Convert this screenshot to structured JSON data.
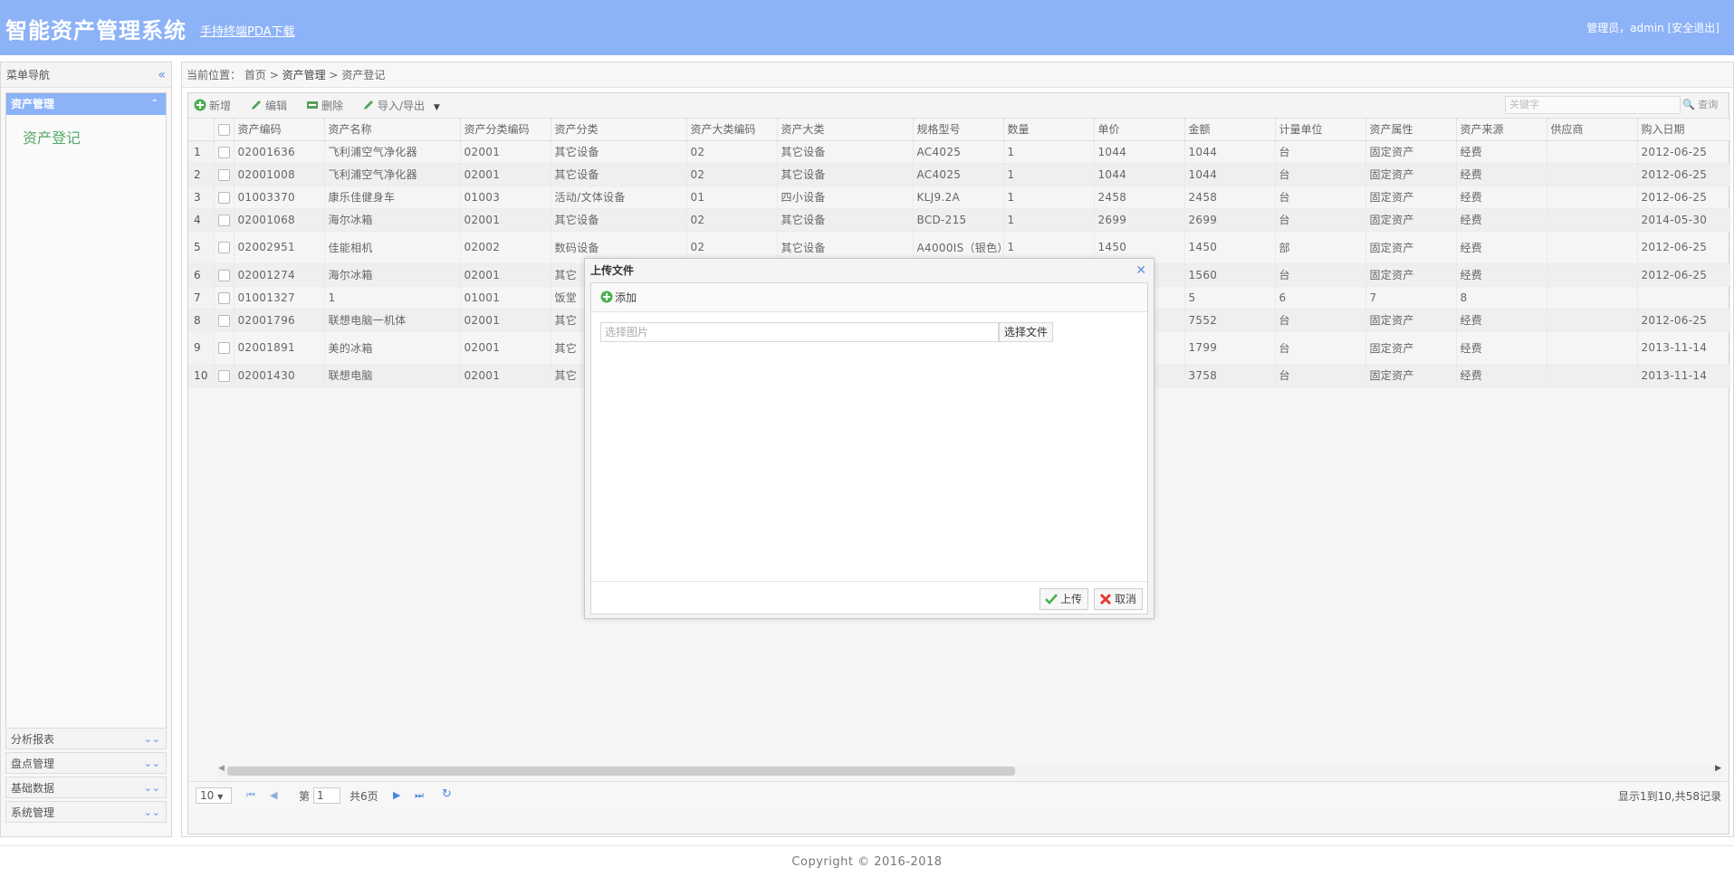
{
  "header": {
    "title": "智能资产管理系统",
    "pda_link": "手持终端PDA下载",
    "user_prefix": "管理员，admin",
    "logout": "[安全退出]"
  },
  "sidebar": {
    "title": "菜单导航",
    "active_panel": "资产管理",
    "active_item": "资产登记",
    "sections": [
      "分析报表",
      "盘点管理",
      "基础数据",
      "系统管理"
    ]
  },
  "breadcrumb": {
    "prefix": "当前位置：",
    "home": "首页",
    "sep1": ">",
    "level1": "资产管理",
    "sep2": ">",
    "level2": "资产登记"
  },
  "toolbar": {
    "add": "新增",
    "edit": "编辑",
    "delete": "删除",
    "import_export": "导入/导出",
    "search_placeholder": "关键字",
    "search": "查询"
  },
  "table": {
    "columns": [
      "资产编码",
      "资产名称",
      "资产分类编码",
      "资产分类",
      "资产大类编码",
      "资产大类",
      "规格型号",
      "数量",
      "单价",
      "金额",
      "计量单位",
      "资产属性",
      "资产来源",
      "供应商",
      "购入日期"
    ],
    "rows": [
      [
        "1",
        "02001636",
        "飞利浦空气净化器",
        "02001",
        "其它设备",
        "02",
        "其它设备",
        "AC4025",
        "1",
        "1044",
        "1044",
        "台",
        "固定资产",
        "经费",
        "",
        "2012-06-25"
      ],
      [
        "2",
        "02001008",
        "飞利浦空气净化器",
        "02001",
        "其它设备",
        "02",
        "其它设备",
        "AC4025",
        "1",
        "1044",
        "1044",
        "台",
        "固定资产",
        "经费",
        "",
        "2012-06-25"
      ],
      [
        "3",
        "01003370",
        "康乐佳健身车",
        "01003",
        "活动/文体设备",
        "01",
        "四小设备",
        "KLJ9.2A",
        "1",
        "2458",
        "2458",
        "台",
        "固定资产",
        "经费",
        "",
        "2012-06-25"
      ],
      [
        "4",
        "02001068",
        "海尔冰箱",
        "02001",
        "其它设备",
        "02",
        "其它设备",
        "BCD-215",
        "1",
        "2699",
        "2699",
        "台",
        "固定资产",
        "经费",
        "",
        "2014-05-30"
      ],
      [
        "5",
        "02002951",
        "佳能相机",
        "02002",
        "数码设备",
        "02",
        "其它设备",
        "A4000IS（银色）",
        "1",
        "1450",
        "1450",
        "部",
        "固定资产",
        "经费",
        "",
        "2012-06-25"
      ],
      [
        "6",
        "02001274",
        "海尔冰箱",
        "02001",
        "其它",
        "",
        "",
        "",
        "",
        "",
        "1560",
        "台",
        "固定资产",
        "经费",
        "",
        "2012-06-25"
      ],
      [
        "7",
        "01001327",
        "1",
        "01001",
        "饭堂",
        "",
        "",
        "",
        "",
        "",
        "5",
        "6",
        "7",
        "8",
        "",
        ""
      ],
      [
        "8",
        "02001796",
        "联想电脑一机体",
        "02001",
        "其它",
        "",
        "",
        "",
        "",
        "",
        "7552",
        "台",
        "固定资产",
        "经费",
        "",
        "2012-06-25"
      ],
      [
        "9",
        "02001891",
        "美的冰箱",
        "02001",
        "其它",
        "",
        "",
        "",
        "",
        "",
        "1799",
        "台",
        "固定资产",
        "经费",
        "",
        "2013-11-14"
      ],
      [
        "10",
        "02001430",
        "联想电脑",
        "02001",
        "其它",
        "",
        "",
        "",
        "",
        "",
        "3758",
        "台",
        "固定资产",
        "经费",
        "",
        "2013-11-14"
      ]
    ]
  },
  "pager": {
    "page_size": "10",
    "page_prefix": "第",
    "page": "1",
    "page_total": "共6页",
    "summary": "显示1到10,共58记录"
  },
  "footer": "Copyright © 2016-2018",
  "dialog": {
    "title": "上传文件",
    "add": "添加",
    "file_placeholder": "选择图片",
    "choose_file": "选择文件",
    "upload": "上传",
    "cancel": "取消"
  },
  "colors": {
    "header_bg": "#8cb2f7",
    "menu_link": "#55a96a",
    "accent_icon": "#5d8fe0"
  }
}
